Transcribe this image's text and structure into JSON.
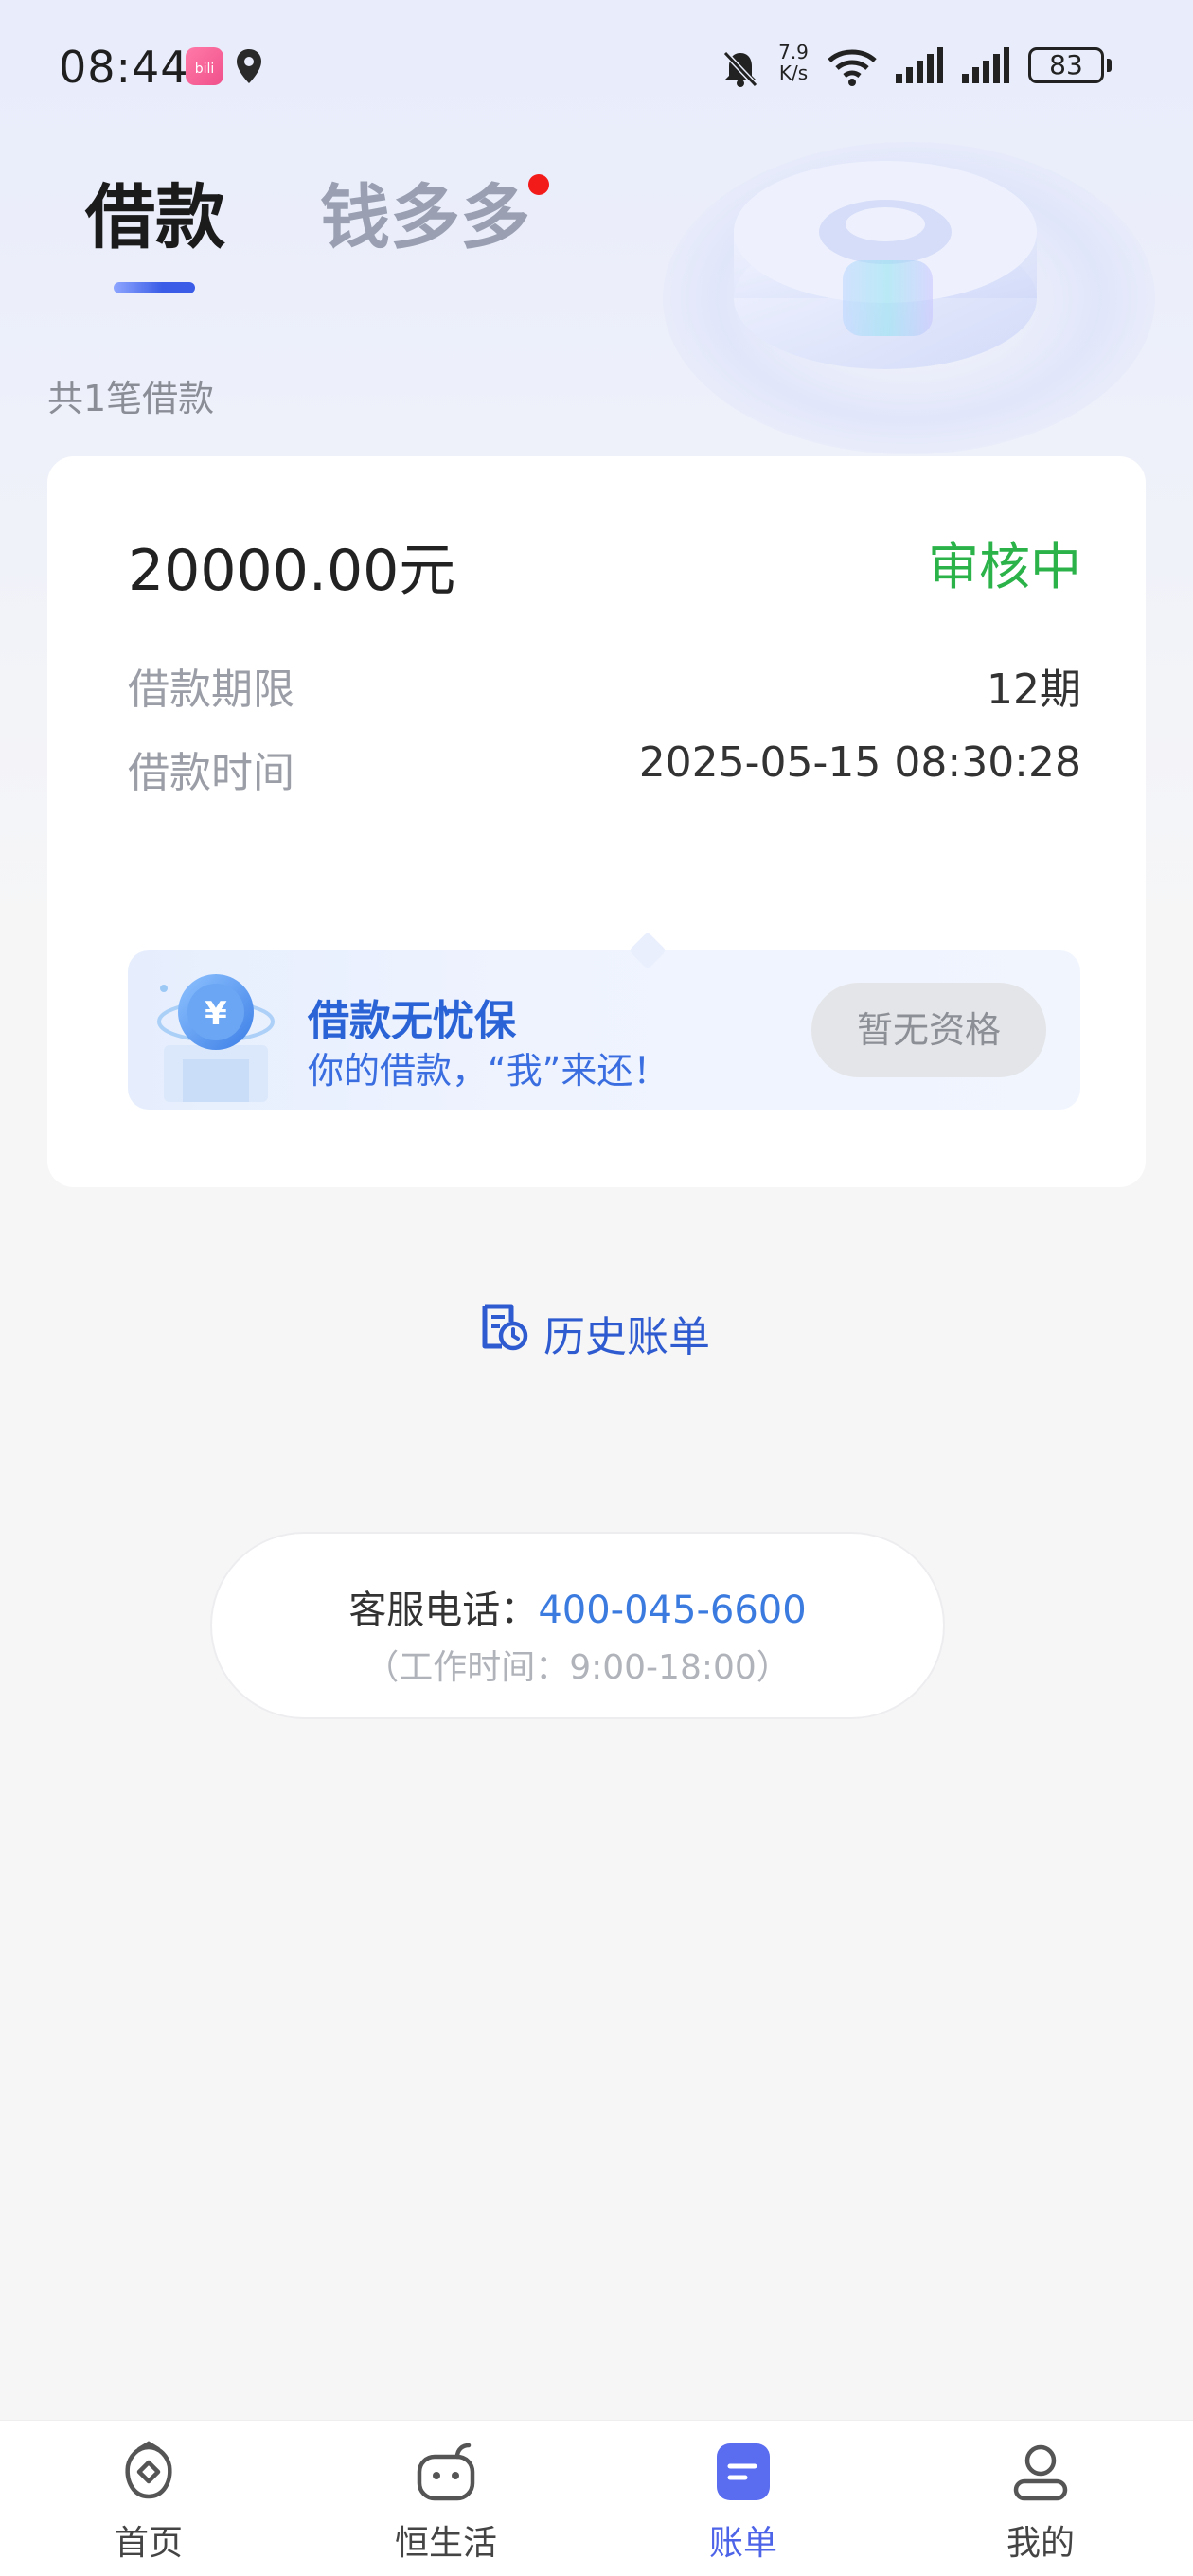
{
  "status_bar": {
    "time": "08:44",
    "net_speed_value": "7.9",
    "net_speed_unit": "K/s",
    "battery": "83"
  },
  "tabs": [
    {
      "label": "借款",
      "active": true
    },
    {
      "label": "钱多多",
      "active": false,
      "badge_dot": true
    }
  ],
  "loan_count_text": "共1笔借款",
  "loan_card": {
    "amount": "20000.00元",
    "status": "审核中",
    "status_color": "#2bb34a",
    "rows": [
      {
        "label": "借款期限",
        "value": "12期"
      },
      {
        "label": "借款时间",
        "value": "2025-05-15 08:30:28"
      }
    ],
    "insurance": {
      "title": "借款无忧保",
      "subtitle": "你的借款，“我”来还！",
      "button_label": "暂无资格"
    }
  },
  "history": {
    "label": "历史账单",
    "icon": "bill-history-icon"
  },
  "customer_service": {
    "label": "客服电话：",
    "phone": "400-045-6600",
    "hours": "（工作时间：9:00-18:00）"
  },
  "bottom_nav": [
    {
      "label": "首页",
      "icon": "home-icon",
      "active": false
    },
    {
      "label": "恒生活",
      "icon": "life-icon",
      "active": false
    },
    {
      "label": "账单",
      "icon": "bill-icon",
      "active": true
    },
    {
      "label": "我的",
      "icon": "profile-icon",
      "active": false
    }
  ],
  "colors": {
    "accent": "#4d63e8",
    "link_blue": "#2f5bd0",
    "phone_blue": "#3b7be0",
    "badge_red": "#f31a1a"
  }
}
